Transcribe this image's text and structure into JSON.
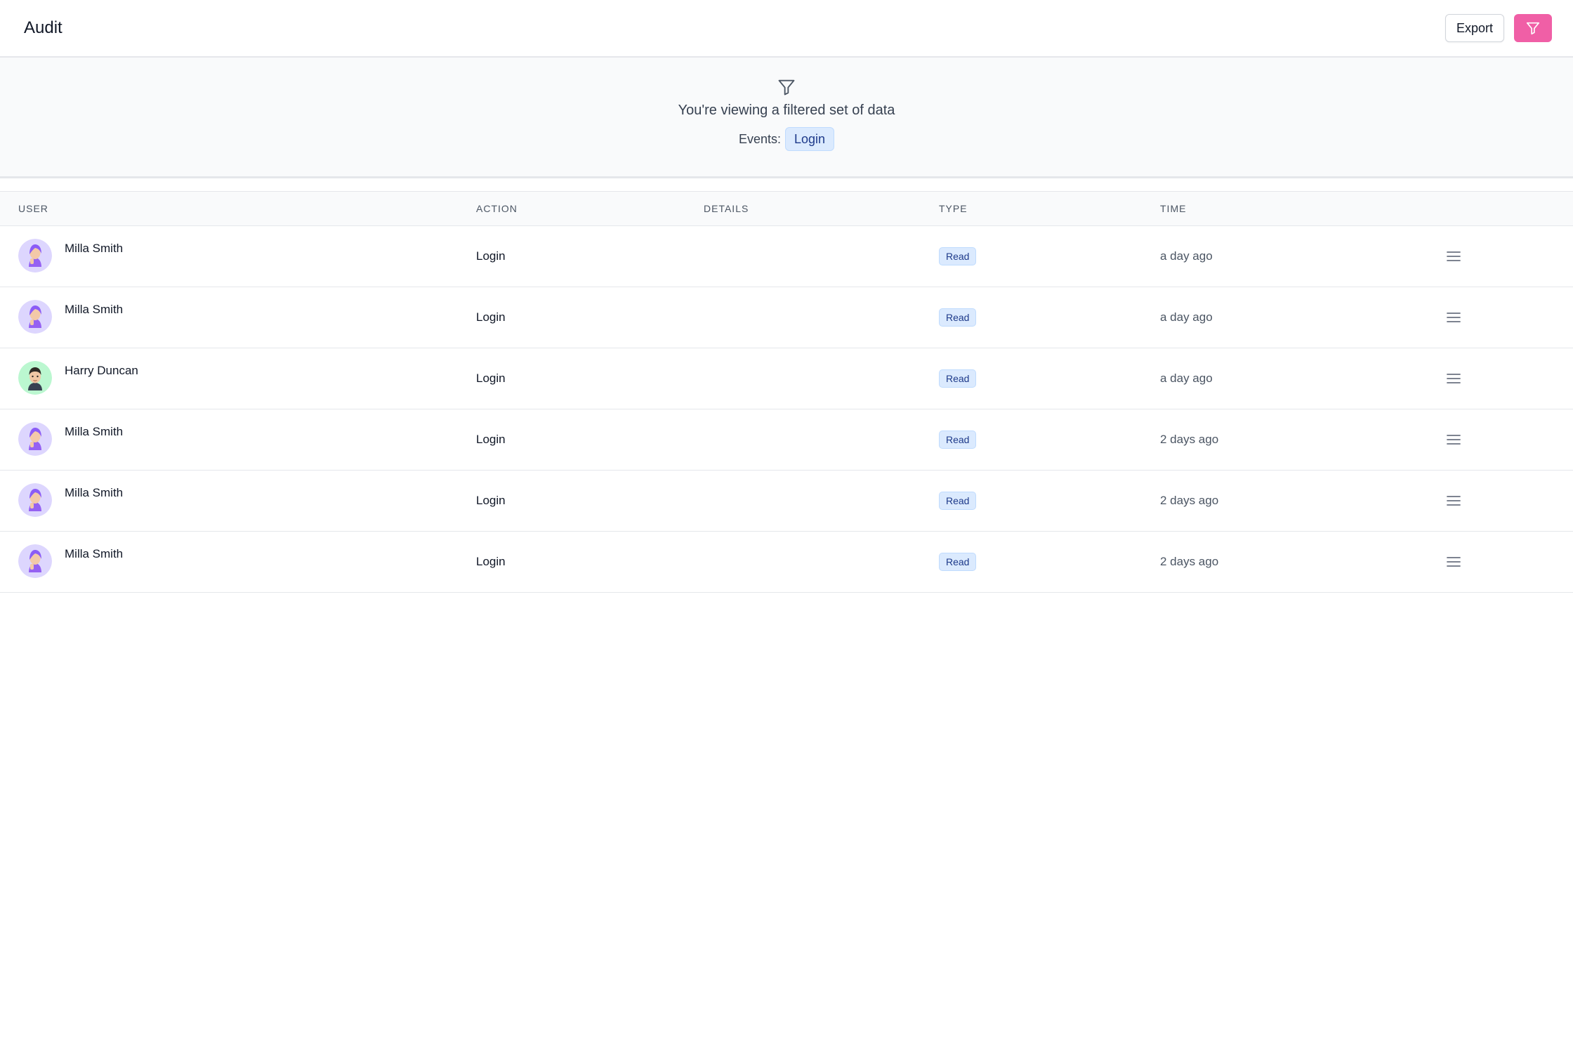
{
  "header": {
    "title": "Audit",
    "export_label": "Export",
    "filter_button_icon": "filter-icon",
    "accent_color": "#f05fa6"
  },
  "filter_banner": {
    "icon": "filter-icon",
    "message": "You're viewing a filtered set of data",
    "filters": [
      {
        "key": "Events:",
        "value": "Login"
      }
    ]
  },
  "table": {
    "columns": [
      "USER",
      "ACTION",
      "DETAILS",
      "TYPE",
      "TIME"
    ],
    "rows": [
      {
        "user": "Milla Smith",
        "avatar": "milla-avatar",
        "action": "Login",
        "details": "",
        "type": "Read",
        "time": "a day ago",
        "menu_icon": "hamburger-menu-icon"
      },
      {
        "user": "Milla Smith",
        "avatar": "milla-avatar",
        "action": "Login",
        "details": "",
        "type": "Read",
        "time": "a day ago",
        "menu_icon": "hamburger-menu-icon"
      },
      {
        "user": "Harry Duncan",
        "avatar": "harry-avatar",
        "action": "Login",
        "details": "",
        "type": "Read",
        "time": "a day ago",
        "menu_icon": "hamburger-menu-icon"
      },
      {
        "user": "Milla Smith",
        "avatar": "milla-avatar",
        "action": "Login",
        "details": "",
        "type": "Read",
        "time": "2 days ago",
        "menu_icon": "hamburger-menu-icon"
      },
      {
        "user": "Milla Smith",
        "avatar": "milla-avatar",
        "action": "Login",
        "details": "",
        "type": "Read",
        "time": "2 days ago",
        "menu_icon": "hamburger-menu-icon"
      },
      {
        "user": "Milla Smith",
        "avatar": "milla-avatar",
        "action": "Login",
        "details": "",
        "type": "Read",
        "time": "2 days ago",
        "menu_icon": "hamburger-menu-icon"
      }
    ]
  },
  "colors": {
    "milla_avatar_bg": "#ddd6fe",
    "harry_avatar_bg": "#bbf7d0",
    "badge_bg": "#dbeafe"
  }
}
